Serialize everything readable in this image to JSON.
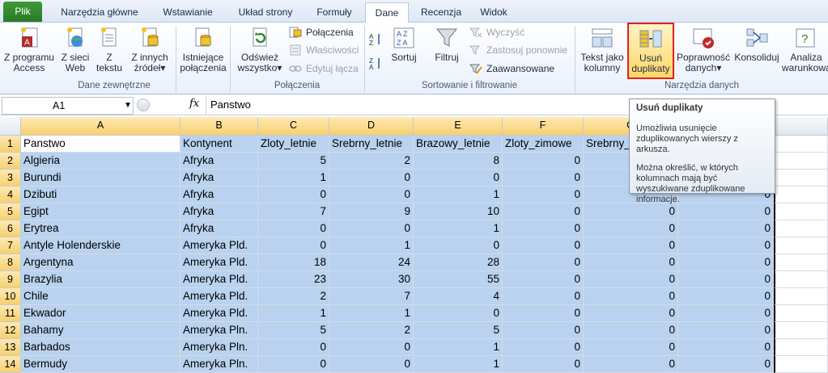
{
  "tabs": [
    "Plik",
    "Narzędzia główne",
    "Wstawianie",
    "Układ strony",
    "Formuły",
    "Dane",
    "Recenzja",
    "Widok"
  ],
  "active_tab": "Dane",
  "ribbon": {
    "external": {
      "access": [
        "Z programu",
        "Access"
      ],
      "web": [
        "Z sieci",
        "Web"
      ],
      "text": [
        "Z",
        "tekstu"
      ],
      "other": [
        "Z innych",
        "źródeł"
      ],
      "existing": [
        "Istniejące",
        "połączenia"
      ],
      "group": "Dane zewnętrzne"
    },
    "connections": {
      "refresh": [
        "Odśwież",
        "wszystko"
      ],
      "connections": "Połączenia",
      "properties": "Właściwości",
      "edit_links": "Edytuj łącza",
      "group": "Połączenia"
    },
    "sort": {
      "sort": "Sortuj",
      "filter": "Filtruj",
      "clear": "Wyczyść",
      "reapply": "Zastosuj ponownie",
      "advanced": "Zaawansowane",
      "group": "Sortowanie i filtrowanie"
    },
    "tools": {
      "text_to_cols": [
        "Tekst jako",
        "kolumny"
      ],
      "remove_dup": [
        "Usuń",
        "duplikaty"
      ],
      "validation": [
        "Poprawność",
        "danych"
      ],
      "consolidate": "Konsoliduj",
      "whatif": [
        "Analiza",
        "warunkowa"
      ],
      "group": "Narzędzia danych"
    }
  },
  "formula_bar": {
    "name_box": "A1",
    "fx": "fx",
    "value": "Panstwo"
  },
  "columns": [
    "A",
    "B",
    "C",
    "D",
    "E",
    "F",
    "G"
  ],
  "rows": [
    {
      "n": "1",
      "a": "Panstwo",
      "b": "Kontynent",
      "c": "Zloty_letnie",
      "d": "Srebrny_letnie",
      "e": "Brazowy_letnie",
      "f": "Zloty_zimowe",
      "g": "Srebrny_zimowe",
      "h": "Brazowy_zimowe"
    },
    {
      "n": "2",
      "a": "Algieria",
      "b": "Afryka",
      "c": "5",
      "d": "2",
      "e": "8",
      "f": "0",
      "g": "",
      "h": ""
    },
    {
      "n": "3",
      "a": "Burundi",
      "b": "Afryka",
      "c": "1",
      "d": "0",
      "e": "0",
      "f": "0",
      "g": "",
      "h": "0"
    },
    {
      "n": "4",
      "a": "Dzibuti",
      "b": "Afryka",
      "c": "0",
      "d": "0",
      "e": "1",
      "f": "0",
      "g": "",
      "h": "0"
    },
    {
      "n": "5",
      "a": "Egipt",
      "b": "Afryka",
      "c": "7",
      "d": "9",
      "e": "10",
      "f": "0",
      "g": "0",
      "h": "0"
    },
    {
      "n": "6",
      "a": "Erytrea",
      "b": "Afryka",
      "c": "0",
      "d": "0",
      "e": "1",
      "f": "0",
      "g": "0",
      "h": "0"
    },
    {
      "n": "7",
      "a": "Antyle Holenderskie",
      "b": "Ameryka Pld.",
      "c": "0",
      "d": "1",
      "e": "0",
      "f": "0",
      "g": "0",
      "h": "0"
    },
    {
      "n": "8",
      "a": "Argentyna",
      "b": "Ameryka Pld.",
      "c": "18",
      "d": "24",
      "e": "28",
      "f": "0",
      "g": "0",
      "h": "0"
    },
    {
      "n": "9",
      "a": "Brazylia",
      "b": "Ameryka Pld.",
      "c": "23",
      "d": "30",
      "e": "55",
      "f": "0",
      "g": "0",
      "h": "0"
    },
    {
      "n": "10",
      "a": "Chile",
      "b": "Ameryka Pld.",
      "c": "2",
      "d": "7",
      "e": "4",
      "f": "0",
      "g": "0",
      "h": "0"
    },
    {
      "n": "11",
      "a": "Ekwador",
      "b": "Ameryka Pld.",
      "c": "1",
      "d": "1",
      "e": "0",
      "f": "0",
      "g": "0",
      "h": "0"
    },
    {
      "n": "12",
      "a": "Bahamy",
      "b": "Ameryka Pln.",
      "c": "5",
      "d": "2",
      "e": "5",
      "f": "0",
      "g": "0",
      "h": "0"
    },
    {
      "n": "13",
      "a": "Barbados",
      "b": "Ameryka Pln.",
      "c": "0",
      "d": "0",
      "e": "1",
      "f": "0",
      "g": "0",
      "h": "0"
    },
    {
      "n": "14",
      "a": "Bermudy",
      "b": "Ameryka Pln.",
      "c": "0",
      "d": "0",
      "e": "1",
      "f": "0",
      "g": "0",
      "h": "0"
    }
  ],
  "tooltip": {
    "title": "Usuń duplikaty",
    "p1": "Umożliwia usunięcie zduplikowanych wierszy z arkusza.",
    "p2": "Można określić, w których kolumnach mają być wyszukiwane zduplikowane informacje."
  },
  "colors": {
    "selection": "#b9d2ef",
    "highlight_box": "#e02020",
    "file_tab": "#2a7a25"
  }
}
